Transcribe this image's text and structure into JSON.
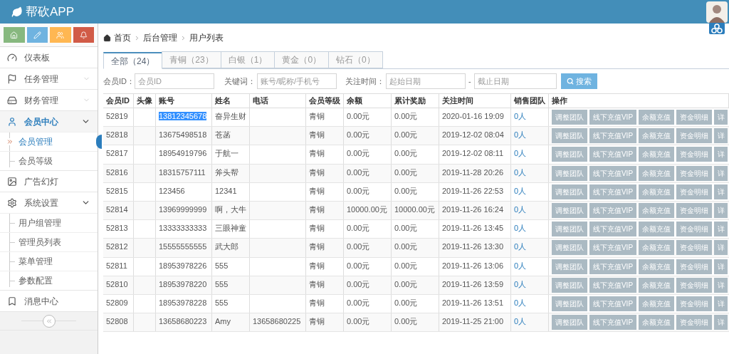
{
  "app": {
    "title": "帮砍APP"
  },
  "shortcuts": [
    {
      "kind": "home",
      "color": "#87b87f"
    },
    {
      "kind": "pencil",
      "color": "#6fb3e0"
    },
    {
      "kind": "users",
      "color": "#ffb752"
    },
    {
      "kind": "bell",
      "color": "#d15b47"
    }
  ],
  "sidebar": {
    "items": [
      {
        "kind": "link",
        "label": "仪表板",
        "selected": false
      },
      {
        "kind": "group",
        "label": "任务管理",
        "expanded": false,
        "selected": false
      },
      {
        "kind": "group",
        "label": "财务管理",
        "expanded": false,
        "selected": false
      },
      {
        "kind": "group",
        "label": "会员中心",
        "expanded": true,
        "selected": true,
        "children": [
          {
            "label": "会员管理",
            "selected": true
          },
          {
            "label": "会员等级",
            "selected": false
          }
        ]
      },
      {
        "kind": "link",
        "label": "广告幻灯",
        "selected": false
      },
      {
        "kind": "group",
        "label": "系统设置",
        "expanded": true,
        "selected": false,
        "children": [
          {
            "label": "用户组管理",
            "selected": false
          },
          {
            "label": "管理员列表",
            "selected": false
          },
          {
            "label": "菜单管理",
            "selected": false
          },
          {
            "label": "参数配置",
            "selected": false
          }
        ]
      },
      {
        "kind": "link",
        "label": "消息中心",
        "selected": false
      }
    ]
  },
  "breadcrumb": [
    "首页",
    "后台管理",
    "用户列表"
  ],
  "tabs": [
    {
      "label": "全部（24）",
      "selected": true
    },
    {
      "label": "青铜（23）",
      "selected": false
    },
    {
      "label": "白银（1）",
      "selected": false
    },
    {
      "label": "黄金（0）",
      "selected": false
    },
    {
      "label": "钻石（0）",
      "selected": false
    }
  ],
  "filters": {
    "member_id": {
      "label": "会员ID：",
      "placeholder": "会员ID"
    },
    "keyword": {
      "label": "关键词：",
      "placeholder": "账号/昵称/手机号"
    },
    "follow_time": {
      "label": "关注时间：",
      "start_placeholder": "起始日期",
      "separator": "-",
      "end_placeholder": "截止日期"
    },
    "search_button": "搜索"
  },
  "table": {
    "columns": [
      "会员ID",
      "头像",
      "账号",
      "姓名",
      "电话",
      "会员等级",
      "余额",
      "累计奖励",
      "关注时间",
      "销售团队",
      "操作"
    ],
    "rows": [
      {
        "cells": [
          "52819",
          "",
          "13812345678",
          "奋异生财",
          "",
          "青铜",
          "0.00元",
          "0.00元",
          "2020-01-16 19:09",
          "0人"
        ],
        "account_highlighted": true,
        "actions": [
          "调整团队",
          "线下充值VIP",
          "余额充值",
          "资金明细",
          "详"
        ]
      },
      {
        "cells": [
          "52818",
          "",
          "13675498518",
          "苍菡",
          "",
          "青铜",
          "0.00元",
          "0.00元",
          "2019-12-02 08:04",
          "0人"
        ],
        "account_highlighted": false,
        "actions": [
          "调整团队",
          "线下充值VIP",
          "余额充值",
          "资金明细",
          "详"
        ]
      },
      {
        "cells": [
          "52817",
          "",
          "18954919796",
          "于航一",
          "",
          "青铜",
          "0.00元",
          "0.00元",
          "2019-12-02 08:11",
          "0人"
        ],
        "account_highlighted": false,
        "actions": [
          "调整团队",
          "线下充值VIP",
          "余额充值",
          "资金明细",
          "详"
        ]
      },
      {
        "cells": [
          "52816",
          "",
          "18315757111",
          "斧头帮",
          "",
          "青铜",
          "0.00元",
          "0.00元",
          "2019-11-28 20:26",
          "0人"
        ],
        "account_highlighted": false,
        "actions": [
          "调整团队",
          "线下充值VIP",
          "余额充值",
          "资金明细",
          "详"
        ]
      },
      {
        "cells": [
          "52815",
          "",
          "123456",
          "12341",
          "",
          "青铜",
          "0.00元",
          "0.00元",
          "2019-11-26 22:53",
          "0人"
        ],
        "account_highlighted": false,
        "actions": [
          "调整团队",
          "线下充值VIP",
          "余额充值",
          "资金明细",
          "详"
        ]
      },
      {
        "cells": [
          "52814",
          "",
          "13969999999",
          "啊，大牛",
          "",
          "青铜",
          "10000.00元",
          "10000.00元",
          "2019-11-26 16:24",
          "0人"
        ],
        "account_highlighted": false,
        "actions": [
          "调整团队",
          "线下充值VIP",
          "余额充值",
          "资金明细",
          "详"
        ]
      },
      {
        "cells": [
          "52813",
          "",
          "13333333333",
          "三眼神童",
          "",
          "青铜",
          "0.00元",
          "0.00元",
          "2019-11-26 13:45",
          "0人"
        ],
        "account_highlighted": false,
        "actions": [
          "调整团队",
          "线下充值VIP",
          "余额充值",
          "资金明细",
          "详"
        ]
      },
      {
        "cells": [
          "52812",
          "",
          "15555555555",
          "武大郎",
          "",
          "青铜",
          "0.00元",
          "0.00元",
          "2019-11-26 13:30",
          "0人"
        ],
        "account_highlighted": false,
        "actions": [
          "调整团队",
          "线下充值VIP",
          "余额充值",
          "资金明细",
          "详"
        ]
      },
      {
        "cells": [
          "52811",
          "",
          "18953978226",
          "555",
          "",
          "青铜",
          "0.00元",
          "0.00元",
          "2019-11-26 13:06",
          "0人"
        ],
        "account_highlighted": false,
        "actions": [
          "调整团队",
          "线下充值VIP",
          "余额充值",
          "资金明细",
          "详"
        ]
      },
      {
        "cells": [
          "52810",
          "",
          "18953978220",
          "555",
          "",
          "青铜",
          "0.00元",
          "0.00元",
          "2019-11-26 13:59",
          "0人"
        ],
        "account_highlighted": false,
        "actions": [
          "调整团队",
          "线下充值VIP",
          "余额充值",
          "资金明细",
          "详"
        ]
      },
      {
        "cells": [
          "52809",
          "",
          "18953978228",
          "555",
          "",
          "青铜",
          "0.00元",
          "0.00元",
          "2019-11-26 13:51",
          "0人"
        ],
        "account_highlighted": false,
        "actions": [
          "调整团队",
          "线下充值VIP",
          "余额充值",
          "资金明细",
          "详"
        ]
      },
      {
        "cells": [
          "52808",
          "",
          "13658680223",
          "Amy",
          "13658680225",
          "青铜",
          "0.00元",
          "0.00元",
          "2019-11-25 21:00",
          "0人"
        ],
        "account_highlighted": false,
        "actions": [
          "调整团队",
          "线下充值VIP",
          "余额充值",
          "资金明细",
          "详"
        ]
      }
    ]
  }
}
